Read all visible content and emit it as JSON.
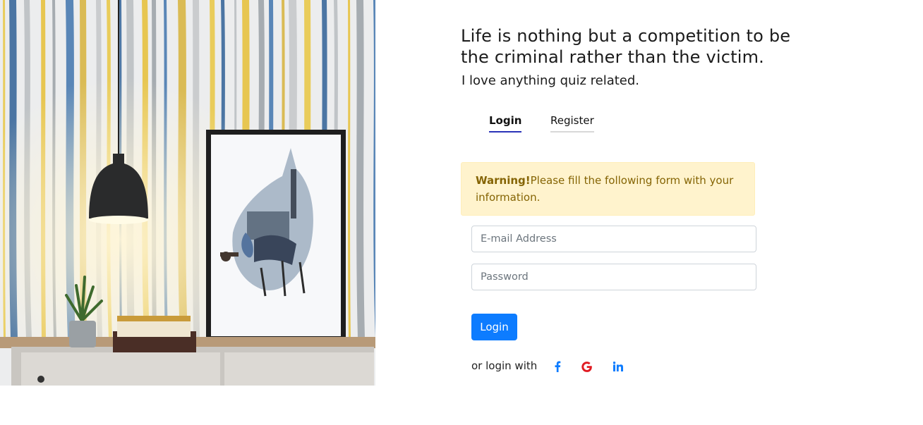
{
  "hero": {
    "image_name": "living-room-wallpaper-lamp-framed-print"
  },
  "headline": "Life is nothing but a competition to be the criminal rather than the victim.",
  "tagline": "I love anything quiz related.",
  "tabs": {
    "login": "Login",
    "register": "Register",
    "active": "Login"
  },
  "alert": {
    "title": "Warning!",
    "message": "Please fill the following form with your information."
  },
  "form": {
    "email_placeholder": "E-mail Address",
    "password_placeholder": "Password",
    "submit_label": "Login"
  },
  "social": {
    "text": "or login with",
    "icons": [
      "facebook-icon",
      "google-icon",
      "linkedin-icon"
    ]
  },
  "colors": {
    "tab_active_underline": "#2b33b8",
    "alert_bg": "#fff3cd",
    "alert_text": "#856404",
    "primary": "#0d7cff",
    "google_red": "#e01b22"
  }
}
